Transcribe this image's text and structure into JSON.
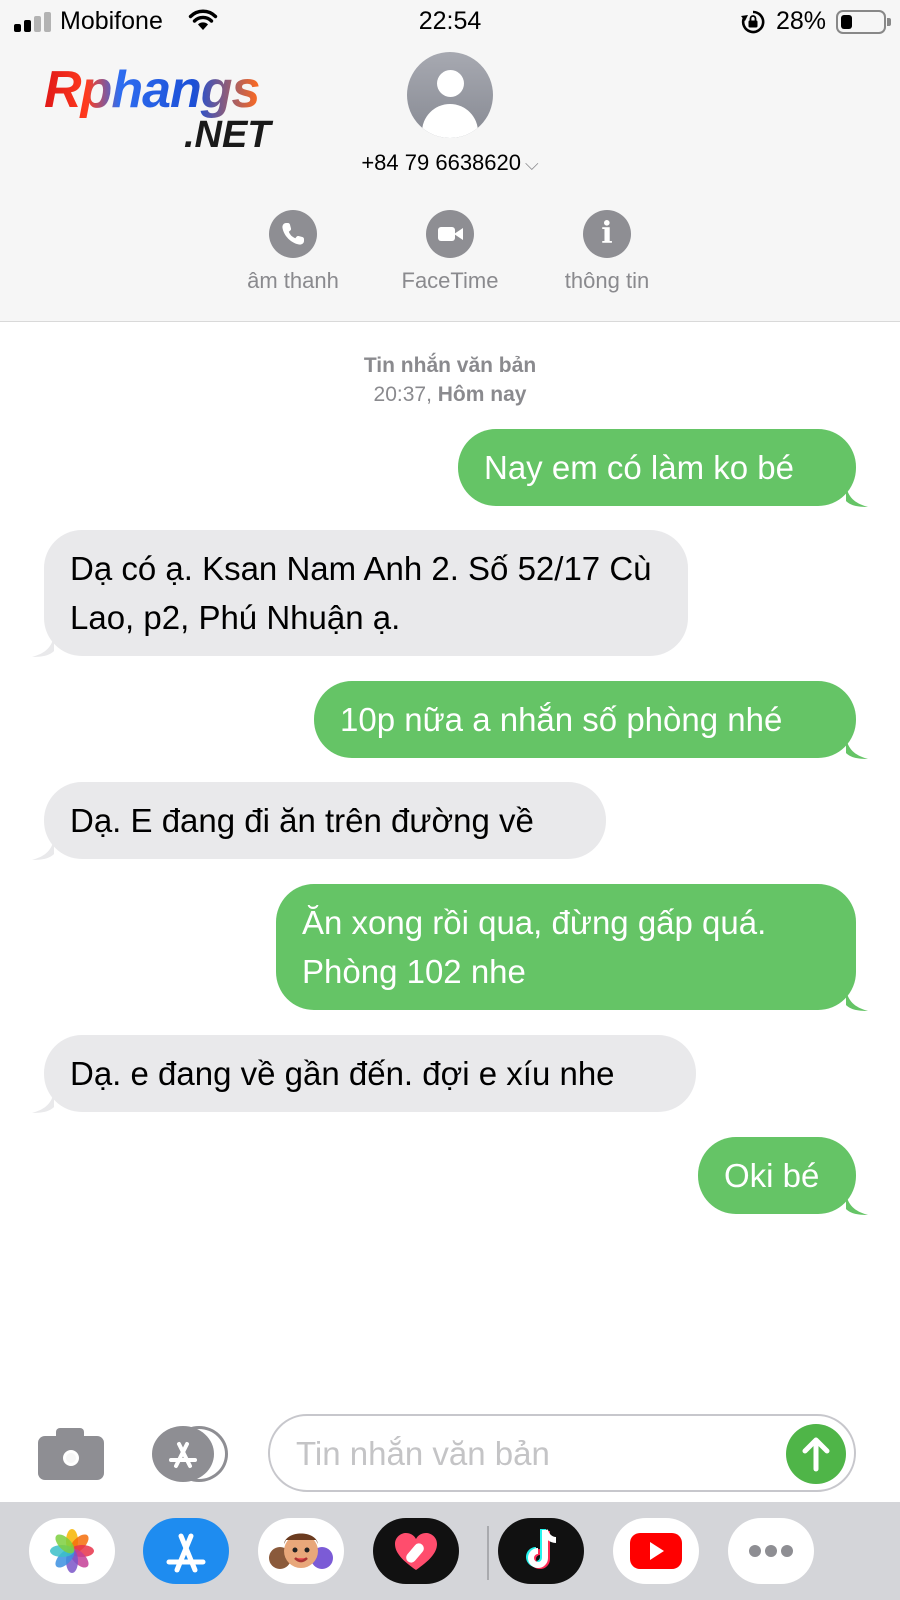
{
  "status_bar": {
    "carrier": "Mobifone",
    "time": "22:54",
    "battery_percent": "28%",
    "battery_level": 0.28,
    "signal_bars": 2,
    "icons": [
      "signal-icon",
      "wifi-icon",
      "rotation-lock-icon",
      "battery-icon"
    ]
  },
  "watermark": {
    "text_main": "Rphangs",
    "text_sub": ".NET"
  },
  "contact": {
    "name": "+84 79 6638620",
    "chevron": "⌵",
    "actions": [
      {
        "label": "âm thanh",
        "icon": "phone-icon"
      },
      {
        "label": "FaceTime",
        "icon": "video-camera-icon"
      },
      {
        "label": "thông tin",
        "icon": "info-icon"
      }
    ]
  },
  "thread": {
    "type_label": "Tin nhắn văn bản",
    "time": "20:37,",
    "day": "Hôm nay"
  },
  "messages": [
    {
      "direction": "outgoing",
      "text": "Nay em có làm ko bé"
    },
    {
      "direction": "incoming",
      "text": "Dạ có ạ. Ksan Nam Anh 2. Số 52/17 Cù Lao, p2, Phú Nhuận ạ."
    },
    {
      "direction": "outgoing",
      "text": "10p nữa a nhắn số phòng nhé"
    },
    {
      "direction": "incoming",
      "text": "Dạ. E đang đi ăn trên đường về"
    },
    {
      "direction": "outgoing",
      "text": "Ăn xong rồi qua, đừng gấp quá. Phòng 102 nhe"
    },
    {
      "direction": "incoming",
      "text": "Dạ. e đang về gần đến. đợi e xíu nhe"
    },
    {
      "direction": "outgoing",
      "text": "Oki bé"
    }
  ],
  "composer": {
    "placeholder": "Tin nhắn văn bản",
    "value": "",
    "icons": [
      "camera-icon",
      "app-store-icon",
      "send-arrow-icon"
    ]
  },
  "app_drawer": {
    "apps": [
      "photos-app-icon",
      "app-store-app-icon",
      "memoji-app-icon",
      "digital-touch-app-icon",
      "tiktok-app-icon",
      "youtube-app-icon",
      "more-apps-icon"
    ]
  },
  "colors": {
    "outgoing_bubble": "#65c466",
    "incoming_bubble": "#e9e9eb",
    "header_bg": "#f6f6f6",
    "icon_gray": "#8e8e93",
    "send_green": "#4fb548"
  }
}
